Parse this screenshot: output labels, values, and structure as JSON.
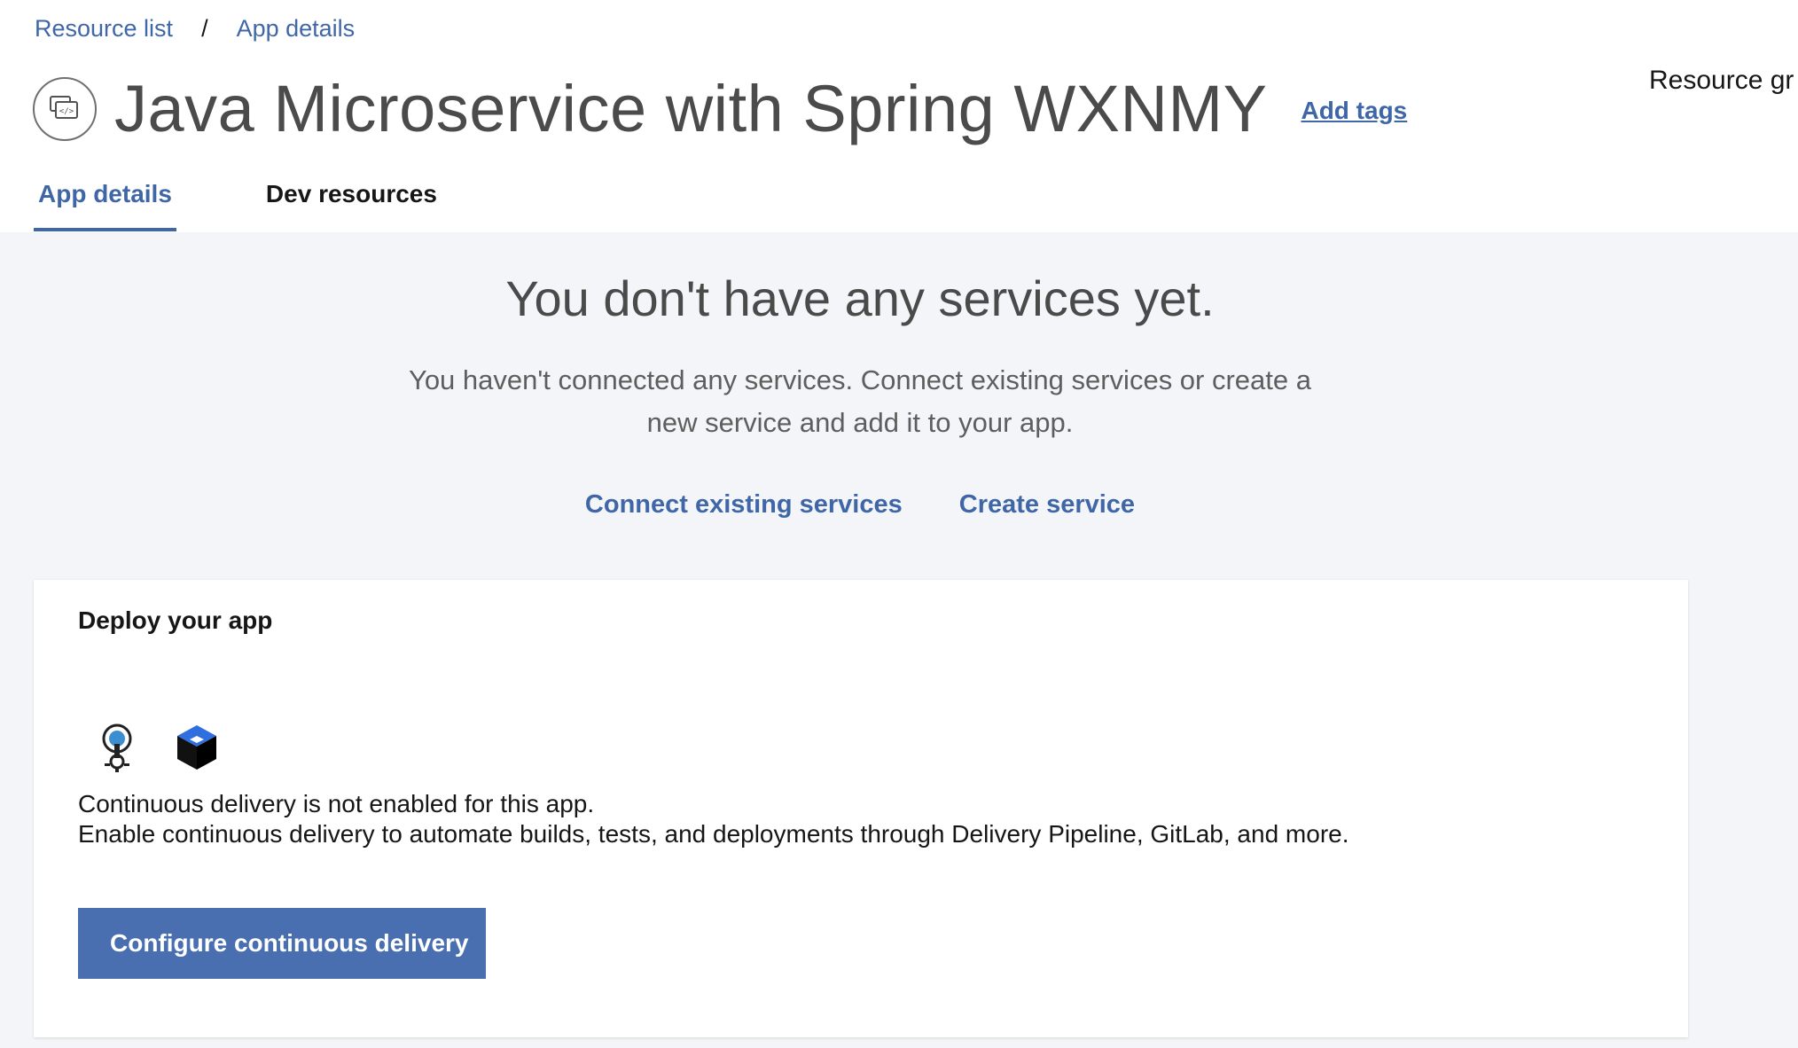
{
  "breadcrumb": {
    "items": [
      "Resource list",
      "App details"
    ],
    "separator": "/"
  },
  "header": {
    "icon": "app-code-icon",
    "title": "Java Microservice with Spring WXNMY",
    "add_tags": "Add tags",
    "resource_group_label": "Resource gr"
  },
  "tabs": [
    {
      "label": "App details",
      "active": true
    },
    {
      "label": "Dev resources",
      "active": false
    }
  ],
  "empty_state": {
    "title": "You don't have any services yet.",
    "desc_line1": "You haven't connected any services. Connect existing services or create a",
    "desc_line2": "new service and add it to your app.",
    "connect_link": "Connect existing services",
    "create_link": "Create service"
  },
  "deploy_card": {
    "title": "Deploy your app",
    "icons": [
      "delivery-pipeline-icon",
      "gitlab-cube-icon"
    ],
    "line1": "Continuous delivery is not enabled for this app.",
    "line2": "Enable continuous delivery to automate builds, tests, and deployments through Delivery Pipeline, GitLab, and more.",
    "button_label": "Configure continuous delivery"
  },
  "colors": {
    "accent": "#3f67a8",
    "button": "#4a6fb1",
    "background": "#f4f5f8"
  }
}
